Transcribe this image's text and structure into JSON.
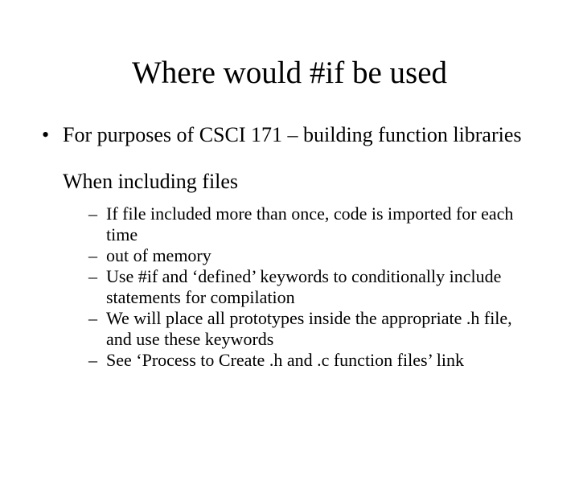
{
  "title": "Where would #if be used",
  "bullets": {
    "main": "For purposes of CSCI 171 – building function libraries",
    "subheading": "When including files",
    "subs": [
      "If file included more than once, code is imported for each time",
      "out of memory",
      "Use #if and ‘defined’ keywords to conditionally include statements for compilation",
      "We will place all prototypes inside the appropriate .h file, and use these keywords",
      "See ‘Process to Create .h and .c function files’ link"
    ]
  }
}
